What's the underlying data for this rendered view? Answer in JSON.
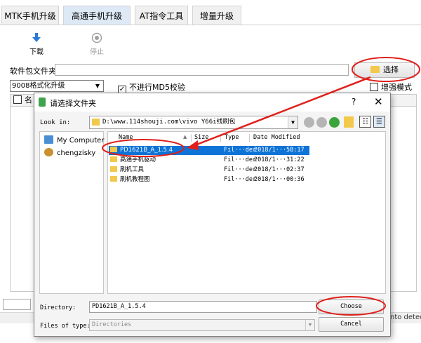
{
  "main": {
    "tabs": [
      {
        "label": "MTK手机升级",
        "active": false
      },
      {
        "label": "高通手机升级",
        "active": true
      },
      {
        "label": "AT指令工具",
        "active": false
      },
      {
        "label": "增量升级",
        "active": false
      }
    ],
    "toolbar": {
      "download_label": "下载",
      "stop_label": "停止"
    },
    "package_folder_label": "软件包文件夹",
    "package_folder_value": "",
    "select_button_label": "选择",
    "mode_select_value": "9008格式化升级",
    "skip_md5_label": "不进行MD5校验",
    "skip_md5_checked": true,
    "enhanced_mode_label": "增强模式",
    "enhanced_mode_checked": false,
    "table_header_first": "名",
    "status_text": "nto detect"
  },
  "dialog": {
    "title": "请选择文件夹",
    "help_label": "?",
    "close_label": "✕",
    "look_in_label": "Look in:",
    "look_in_path": "D:\\www.114shouji.com\\vivo Y66i线刷包",
    "sidebar": [
      {
        "label": "My Computer",
        "icon": "computer-icon"
      },
      {
        "label": "chengzisky",
        "icon": "user-icon"
      }
    ],
    "columns": [
      "Name",
      "Size",
      "Type",
      "Date Modified"
    ],
    "files": [
      {
        "name": "PD1621B_A_1.5.4",
        "type": "Fil···der",
        "date": "2018/1···58:17",
        "selected": true
      },
      {
        "name": "高通手机驱动",
        "type": "Fil···der",
        "date": "2018/1···31:22",
        "selected": false
      },
      {
        "name": "刷机工具",
        "type": "Fil···der",
        "date": "2018/1···02:37",
        "selected": false
      },
      {
        "name": "刷机教程图",
        "type": "Fil···der",
        "date": "2018/1···00:36",
        "selected": false
      }
    ],
    "directory_label": "Directory:",
    "directory_value": "PD1621B_A_1.5.4",
    "files_of_type_label": "Files of type:",
    "files_of_type_value": "Directories",
    "choose_label": "Choose",
    "cancel_label": "Cancel"
  },
  "colors": {
    "annotation_red": "#e0201b",
    "selection_blue": "#0d73d6",
    "folder_yellow": "#f2c94c"
  }
}
